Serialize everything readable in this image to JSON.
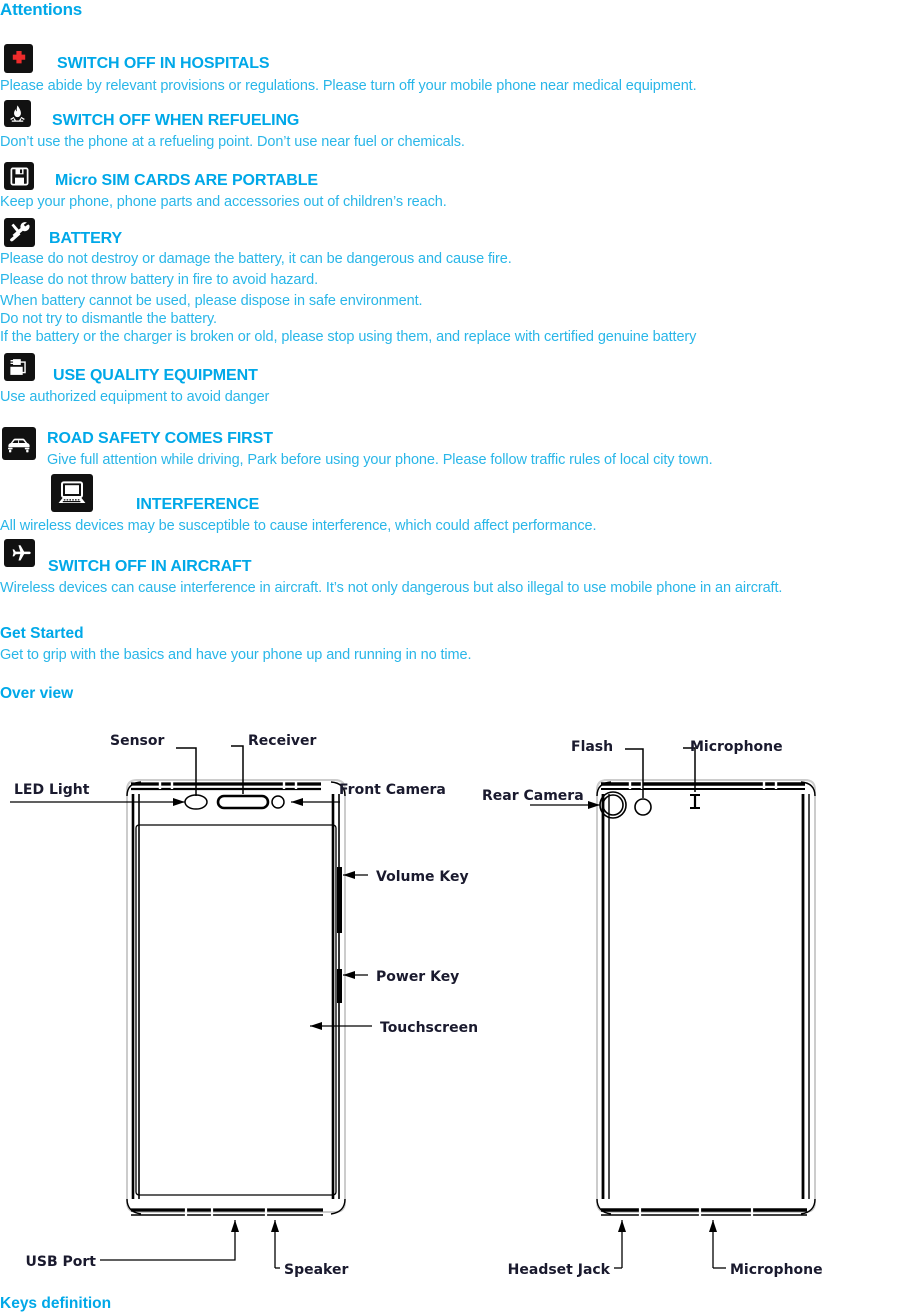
{
  "document": {
    "sections": {
      "attentions": "Attentions",
      "get_started": "Get Started",
      "get_started_body": "Get to grip with the basics and have your phone up and running in no time.",
      "over_view": "Over view",
      "keys_definition": "Keys definition"
    },
    "accent_color": "#00a8e8",
    "body_color": "#29b6e8",
    "icon_bg_color": "#111111",
    "attentions": [
      {
        "icon": "medical-cross-icon",
        "title": "SWITCH OFF IN HOSPITALS",
        "lines": [
          "Please abide by relevant provisions or regulations. Please turn off your mobile phone near medical equipment."
        ]
      },
      {
        "icon": "fire-flame-icon",
        "title": "SWITCH OFF WHEN REFUELING",
        "lines": [
          "Don’t use the phone at a refueling point. Don’t use near fuel or chemicals."
        ]
      },
      {
        "icon": "floppy-disk-icon",
        "title": "Micro SIM CARDS ARE PORTABLE",
        "lines": [
          "Keep your phone, phone parts and accessories out of children’s reach."
        ]
      },
      {
        "icon": "tools-hammer-wrench-icon",
        "title": "BATTERY",
        "lines": [
          "Please do not destroy or damage the battery, it can be dangerous and cause fire.",
          "Please do not throw battery in fire to avoid hazard.",
          "When battery cannot be used, please dispose in safe environment.",
          "Do not try to dismantle the battery.",
          "If the battery or the charger is broken or old, please stop using them, and replace with certified genuine battery"
        ]
      },
      {
        "icon": "charger-equipment-icon",
        "title": "USE QUALITY EQUIPMENT",
        "lines": [
          "Use authorized equipment to avoid danger"
        ]
      },
      {
        "icon": "car-icon",
        "title": "ROAD SAFETY COMES FIRST",
        "lines": [
          "Give full attention while driving, Park before using your phone. Please follow traffic rules of local city town."
        ]
      },
      {
        "icon": "laptop-computer-icon",
        "title": "INTERFERENCE",
        "lines": [
          "All wireless devices may be susceptible to cause interference, which could affect performance."
        ]
      },
      {
        "icon": "airplane-icon",
        "title": "SWITCH OFF IN AIRCRAFT",
        "lines": [
          "Wireless devices can cause interference in aircraft. It’s not only dangerous but also illegal to use mobile phone in an aircraft."
        ]
      }
    ],
    "diagram": {
      "front_labels": {
        "sensor": "Sensor",
        "receiver": "Receiver",
        "led_light": "LED Light",
        "front_camera": "Front Camera",
        "volume_key": "Volume Key",
        "power_key": "Power Key",
        "touchscreen": "Touchscreen",
        "usb_port": "USB Port",
        "speaker": "Speaker"
      },
      "back_labels": {
        "flash": "Flash",
        "microphone_top": "Microphone",
        "rear_camera": "Rear Camera",
        "headset_jack": "Headset Jack",
        "microphone_bottom": "Microphone"
      }
    }
  }
}
